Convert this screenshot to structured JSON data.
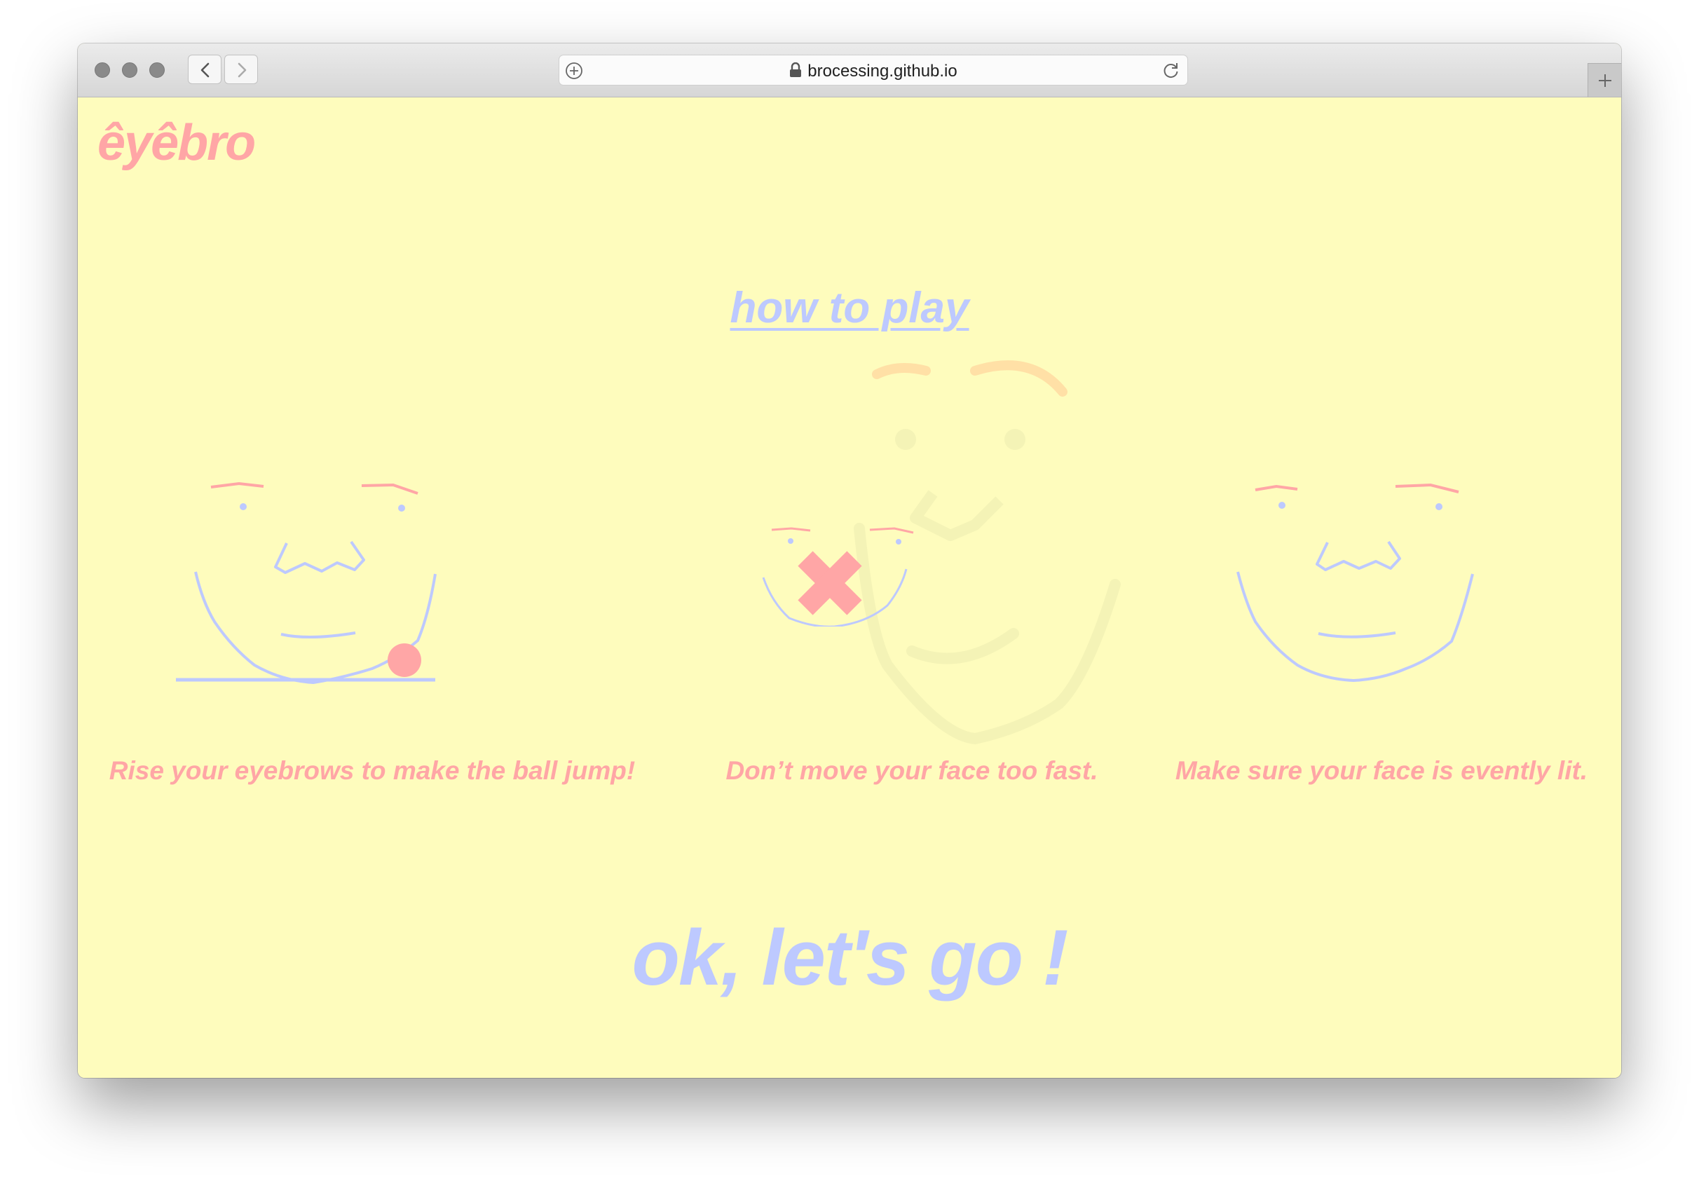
{
  "browser": {
    "url": "brocessing.github.io",
    "icons": [
      "close-light",
      "minimize-light",
      "zoom-light",
      "back-arrow-icon",
      "forward-arrow-icon",
      "add-tab-plus-icon",
      "lock-icon",
      "reload-icon",
      "new-tab-icon"
    ]
  },
  "page": {
    "logo": "êyêbro",
    "how_to_play": "how to play",
    "tips": [
      "Rise your eyebrows to make the ball jump!",
      "Don’t move your face too fast.",
      "Make sure your face is evently lit."
    ],
    "start_button": "ok, let's go !"
  },
  "colors": {
    "background": "#fefcbd",
    "pink": "#ffa6a6",
    "lavender": "#bdc9ff",
    "faint_face": "#f4f3b6",
    "faint_brow": "#ffe0a6"
  }
}
